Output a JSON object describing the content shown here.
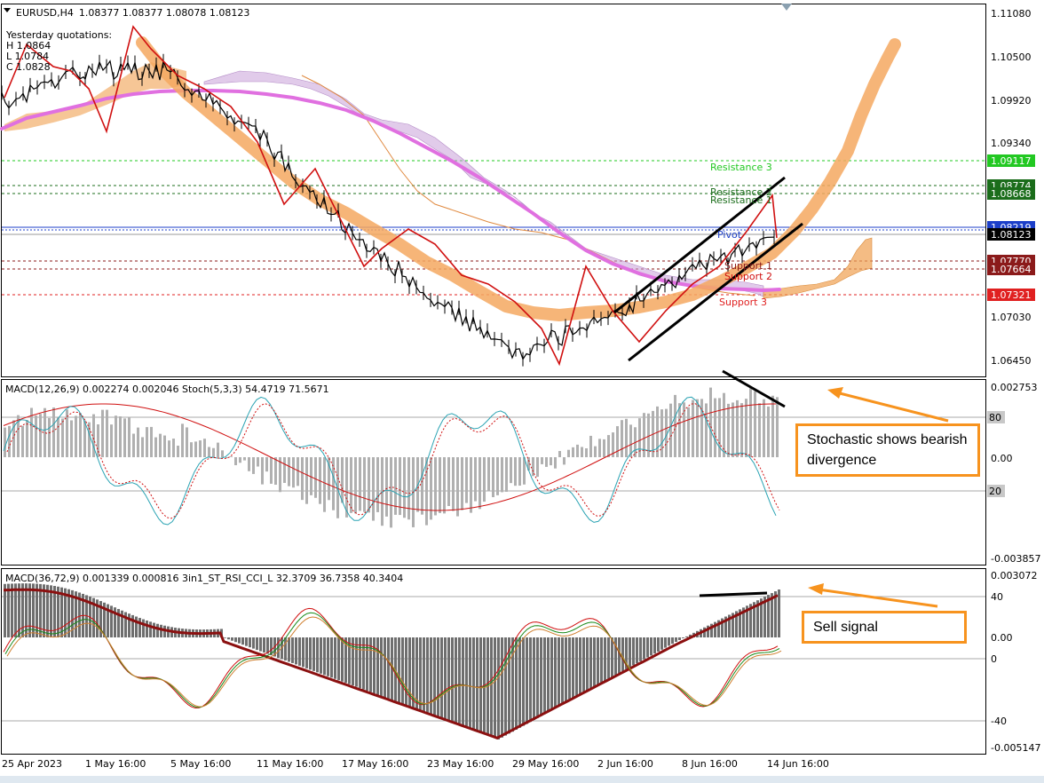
{
  "header": {
    "symbol": "EURUSD,H4",
    "quote": "1.08377 1.08377 1.08078 1.08123",
    "yesterday_title": "Yesterday quotations:",
    "yesterday_h": "H 1.0864",
    "yesterday_l": "L 1.0784",
    "yesterday_c": "C 1.0828"
  },
  "price_axis": {
    "labels": [
      "1.11080",
      "1.10500",
      "1.09920",
      "1.09340",
      "1.07030",
      "1.06450"
    ],
    "tags": [
      {
        "text": "1.09117",
        "color": "#22c822"
      },
      {
        "text": "1.08774",
        "color": "#1b6d1b"
      },
      {
        "text": "1.08668",
        "color": "#1b6d1b"
      },
      {
        "text": "1.08219",
        "color": "#1c3fc9"
      },
      {
        "text": "1.08123",
        "color": "#000000"
      },
      {
        "text": "1.07770",
        "color": "#8b1a1a"
      },
      {
        "text": "1.07664",
        "color": "#8b1a1a"
      },
      {
        "text": "1.07321",
        "color": "#e02020"
      }
    ]
  },
  "levels": {
    "resistance3": "Resistance 3",
    "resistance2": "Resistance 2",
    "resistance1": "Resistance 1",
    "pivot": "Pivot",
    "support1": "Support 1",
    "support2": "Support 2",
    "support3": "Support 3"
  },
  "indicator1": {
    "header": "MACD(12,26,9) 0.002274 0.002046  Stoch(5,3,3) 54.4719 71.5671",
    "axis_top": "0.002753",
    "axis_80": "80",
    "axis_zero": "0.00",
    "axis_20": "20",
    "axis_bottom": "-0.003857"
  },
  "indicator2": {
    "header": "MACD(36,72,9) 0.001339 0.000816  3in1_ST_RSI_CCI_L 32.3709 36.7358 40.3404",
    "axis_top": "0.003072",
    "axis_40": "40",
    "axis_zero": "0.00",
    "axis_0": "0",
    "axis_m40": "-40",
    "axis_bottom": "-0.005147"
  },
  "time_axis": [
    "25 Apr 2023",
    "1 May 16:00",
    "5 May 16:00",
    "11 May 16:00",
    "17 May 16:00",
    "23 May 16:00",
    "29 May 16:00",
    "2 Jun 16:00",
    "8 Jun 16:00",
    "14 Jun 16:00"
  ],
  "annotations": {
    "stoch_callout": "Stochastic shows bearish divergence",
    "sell_callout": "Sell signal"
  },
  "colors": {
    "ma_band": "#f5a860",
    "ma_pink": "#e070e0",
    "zigzag": "#d01010",
    "cloud": "#c9a0d8",
    "cloud_orange": "#f0a050",
    "macd_hist": "#b0b0b0",
    "macd2_hist": "#6e6e6e",
    "callout": "#f7931e"
  },
  "chart_data": {
    "type": "line",
    "title": "EURUSD,H4",
    "x": [
      "25 Apr 2023",
      "1 May 16:00",
      "5 May 16:00",
      "11 May 16:00",
      "17 May 16:00",
      "23 May 16:00",
      "29 May 16:00",
      "2 Jun 16:00",
      "8 Jun 16:00",
      "14 Jun 16:00"
    ],
    "series": [
      {
        "values": [
          1.099,
          1.103,
          1.103,
          1.095,
          1.083,
          1.074,
          1.066,
          1.07,
          1.076,
          1.0812
        ]
      }
    ],
    "ylim": [
      1.063,
      1.1118
    ],
    "last_price": 1.08123,
    "levels": {
      "Resistance 3": 1.09117,
      "Resistance 2": 1.08774,
      "Resistance 1": 1.08668,
      "Pivot": 1.08219,
      "Support 1": 1.0777,
      "Support 2": 1.07664,
      "Support 3": 1.07321
    }
  }
}
